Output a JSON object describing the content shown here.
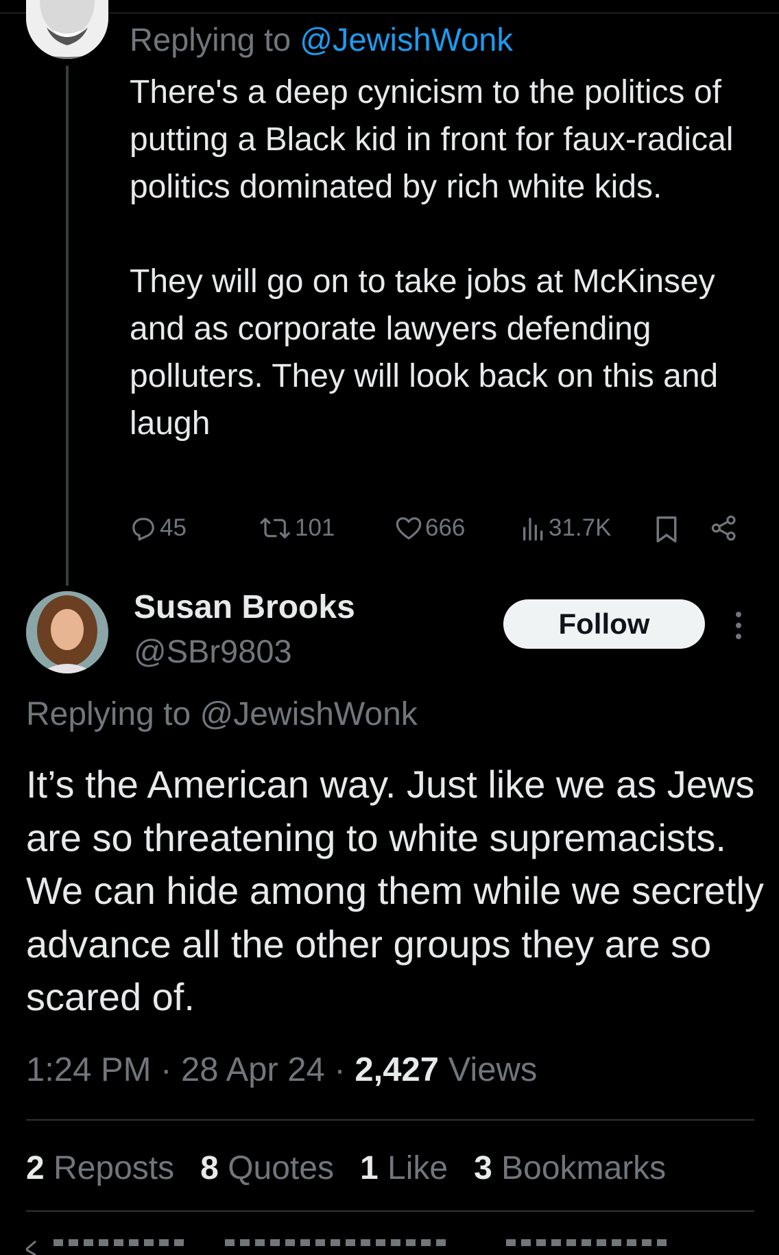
{
  "parent_tweet": {
    "replying_prefix": "Replying to",
    "replying_to": "@JewishWonk",
    "paragraphs": [
      "There's a deep cynicism to the politics of putting a Black kid in front for faux-radical politics dominated by rich white kids.",
      "They will go on to take jobs at McKinsey and as corporate lawyers defending polluters. They will look back on this and laugh"
    ],
    "actions": {
      "replies": "45",
      "reposts": "101",
      "likes": "666",
      "views": "31.7K"
    }
  },
  "reply_tweet": {
    "author_name": "Susan Brooks",
    "author_handle": "@SBr9803",
    "follow_label": "Follow",
    "replying_prefix": "Replying to",
    "replying_to": "@JewishWonk",
    "body": "It’s the American way. Just like we as Jews are so threatening to white supremacists. We can hide among them while we secretly advance all the other groups they are so scared of.",
    "time": "1:24 PM",
    "date": "28 Apr 24",
    "views_count": "2,427",
    "views_label": "Views",
    "stats": {
      "reposts_count": "2",
      "reposts_label": "Reposts",
      "quotes_count": "8",
      "quotes_label": "Quotes",
      "likes_count": "1",
      "likes_label": "Like",
      "bookmarks_count": "3",
      "bookmarks_label": "Bookmarks"
    }
  },
  "colors": {
    "background": "#000000",
    "text_primary": "#e7e9ea",
    "text_secondary": "#71767b",
    "link": "#1d9bf0",
    "follow_bg": "#eff3f4"
  },
  "icons": [
    "reply-icon",
    "repost-icon",
    "like-icon",
    "views-icon",
    "bookmark-icon",
    "share-icon",
    "more-icon"
  ]
}
